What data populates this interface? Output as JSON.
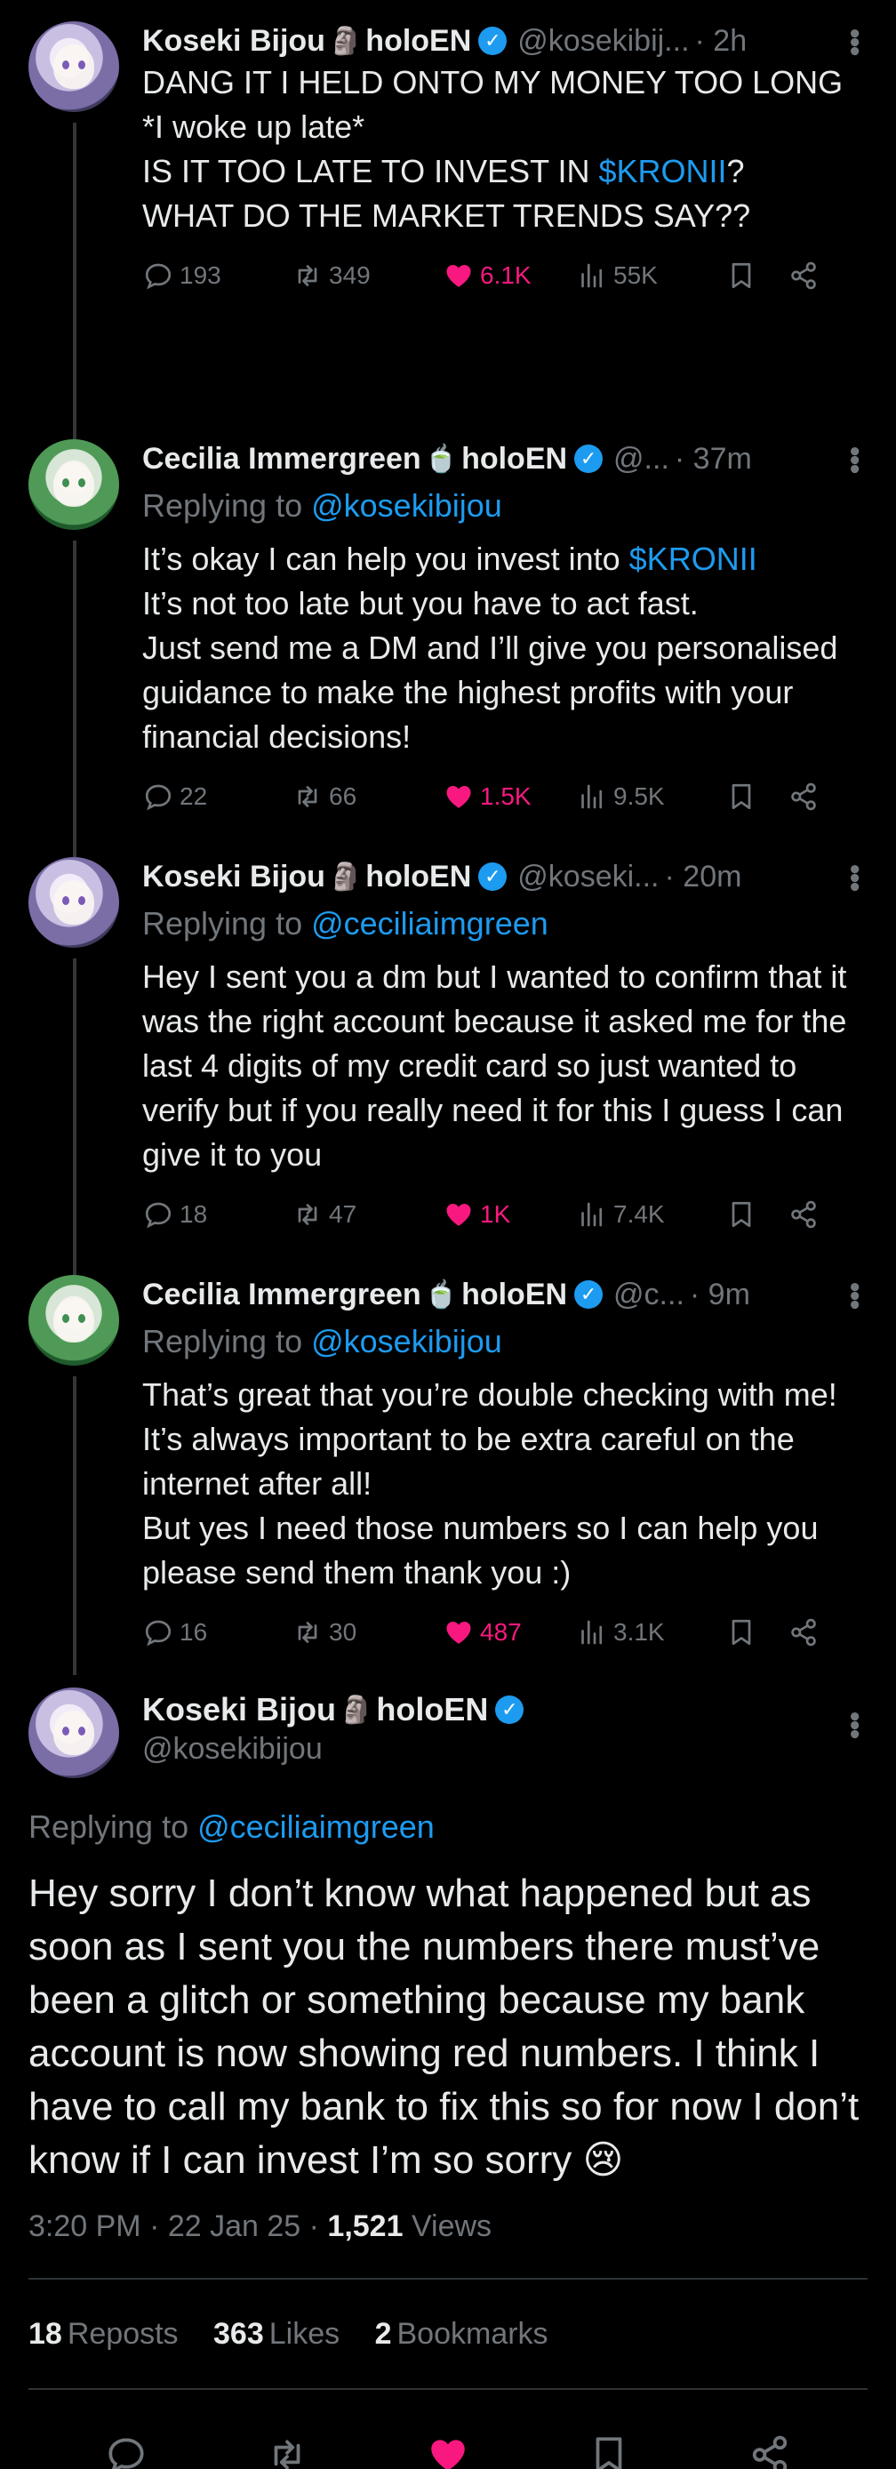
{
  "posts": [
    {
      "name": "Koseki Bijou",
      "emoji": "🗿",
      "tag": "holoEN",
      "handle": "@kosekibij...",
      "time": "· 2h",
      "replying_prefix": "",
      "replying_to": "",
      "text_parts": [
        "DANG IT I HELD ONTO MY MONEY TOO LONG\n*I woke up late*\nIS IT TOO LATE TO INVEST IN ",
        "$KRONII",
        "?\nWHAT DO THE MARKET TRENDS SAY??"
      ],
      "replies": "193",
      "reposts": "349",
      "likes": "6.1K",
      "views": "55K"
    },
    {
      "name": "Cecilia Immergreen",
      "emoji": "🍵",
      "tag": "holoEN",
      "handle": "@...",
      "time": "· 37m",
      "replying_prefix": "Replying to ",
      "replying_to": "@kosekibijou",
      "text_parts": [
        "It’s okay I can help you invest into ",
        "$KRONII",
        "\nIt’s not too late but you have to act fast.\nJust send me a DM and I’ll give you personalised guidance to make the highest profits with your financial decisions!"
      ],
      "replies": "22",
      "reposts": "66",
      "likes": "1.5K",
      "views": "9.5K"
    },
    {
      "name": "Koseki Bijou",
      "emoji": "🗿",
      "tag": "holoEN",
      "handle": "@koseki...",
      "time": "· 20m",
      "replying_prefix": "Replying to ",
      "replying_to": "@ceciliaimgreen",
      "text_parts": [
        "Hey I sent you a dm but I wanted to confirm that it was the right account because it asked me for the last 4 digits of my credit card so just wanted to verify but if you really need it for this I guess I can give it to you",
        "",
        ""
      ],
      "replies": "18",
      "reposts": "47",
      "likes": "1K",
      "views": "7.4K"
    },
    {
      "name": "Cecilia Immergreen",
      "emoji": "🍵",
      "tag": "holoEN",
      "handle": "@c...",
      "time": "· 9m",
      "replying_prefix": "Replying to ",
      "replying_to": "@kosekibijou",
      "text_parts": [
        "That’s great that you’re double checking with me! It’s always important to be extra careful on the internet after all!\nBut yes I need those numbers so I can help you please send them thank you :)",
        "",
        ""
      ],
      "replies": "16",
      "reposts": "30",
      "likes": "487",
      "views": "3.1K"
    }
  ],
  "main": {
    "name": "Koseki Bijou",
    "emoji": "🗿",
    "tag": "holoEN",
    "handle": "@kosekibijou",
    "replying_prefix": "Replying to ",
    "replying_to": "@ceciliaimgreen",
    "text": "Hey sorry I don’t know what happened but as soon as I sent you the numbers there must’ve been a glitch or something because my bank account is now showing red numbers. I think I have to call my bank to fix this so for now I don’t know if I can invest I’m so sorry 😢",
    "timestamp": "3:20 PM · 22 Jan 25 · ",
    "views_count": "1,521",
    "views_label": " Views",
    "reposts_count": "18",
    "reposts_label": "Reposts",
    "likes_count": "363",
    "likes_label": "Likes",
    "bookmarks_count": "2",
    "bookmarks_label": "Bookmarks"
  },
  "colors": {
    "accent": "#1d9bf0",
    "like": "#f91880",
    "muted": "#71767b",
    "background": "#000000"
  },
  "icons": [
    "reply-icon",
    "repost-icon",
    "heart-icon",
    "views-icon",
    "bookmark-icon",
    "share-icon",
    "verified-icon",
    "more-icon"
  ]
}
